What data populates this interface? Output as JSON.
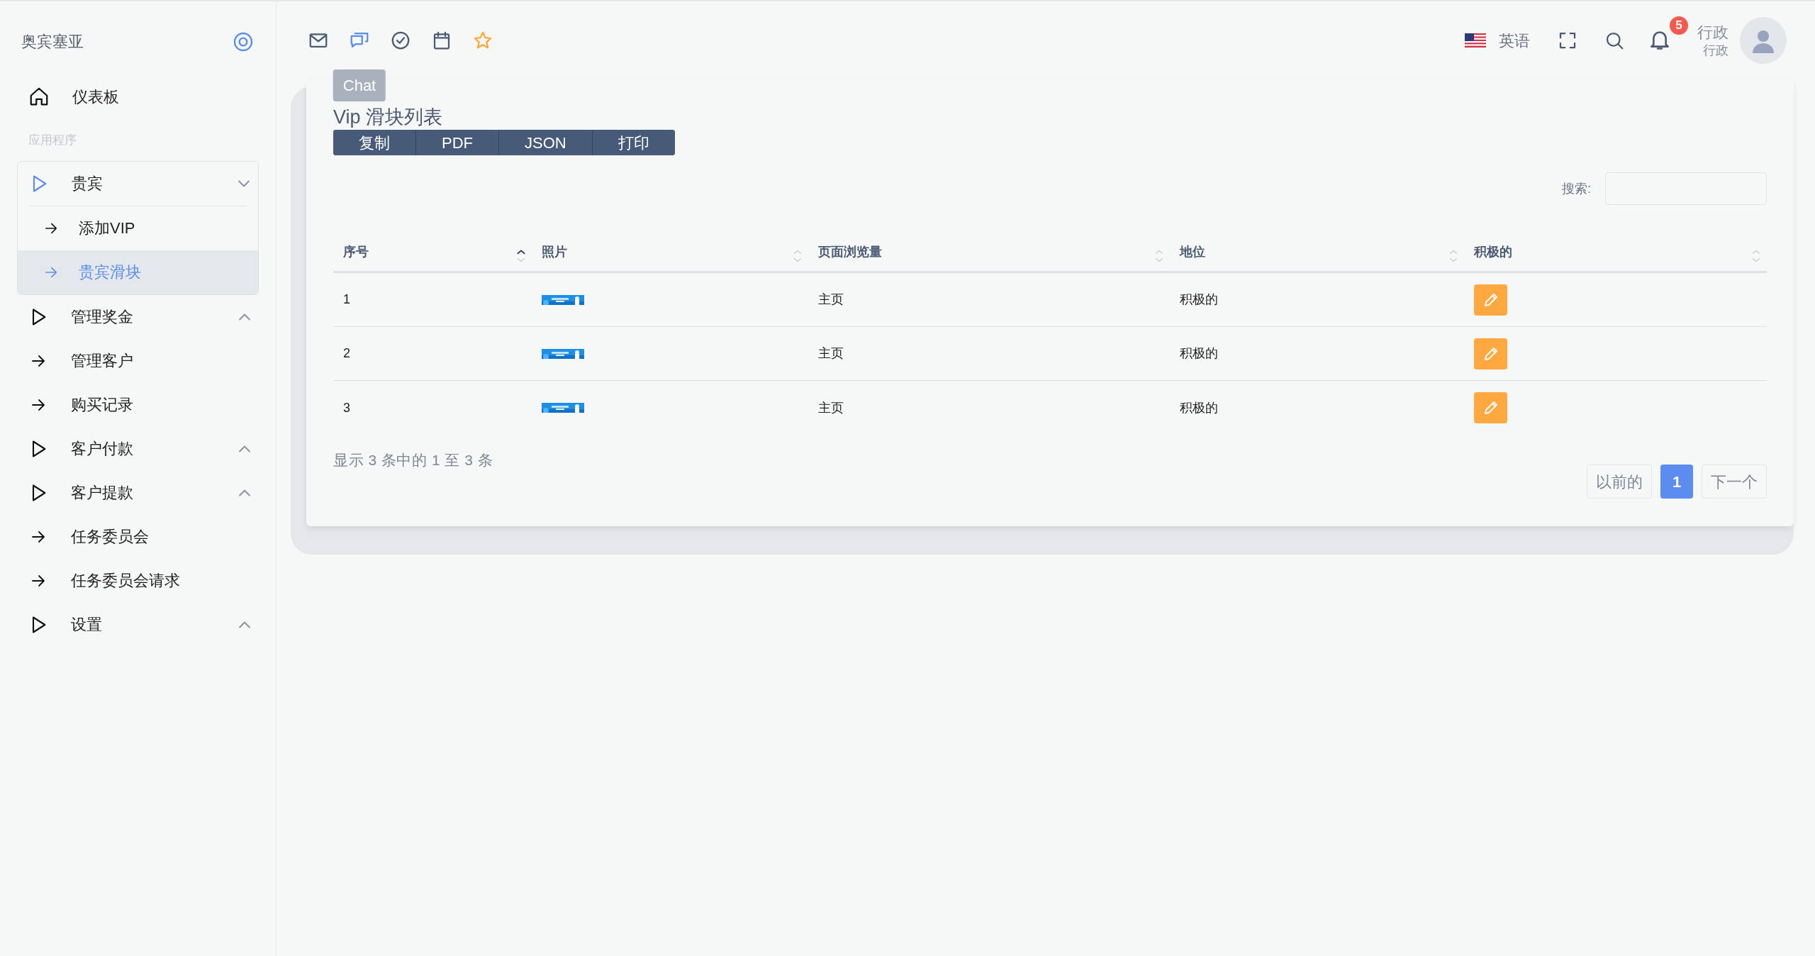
{
  "sidebar": {
    "brand": "奥宾塞亚",
    "items": [
      {
        "kind": "home",
        "label": "仪表板"
      },
      {
        "kind": "section",
        "label": "应用程序"
      },
      {
        "kind": "group",
        "label": "贵宾",
        "expanded": true,
        "children": [
          {
            "label": "添加VIP",
            "selected": false
          },
          {
            "label": "贵宾滑块",
            "selected": true
          }
        ]
      },
      {
        "kind": "group",
        "label": "管理奖金",
        "expanded": false
      },
      {
        "kind": "link",
        "label": "管理客户"
      },
      {
        "kind": "link",
        "label": "购买记录"
      },
      {
        "kind": "group",
        "label": "客户付款",
        "expanded": false
      },
      {
        "kind": "group",
        "label": "客户提款",
        "expanded": false
      },
      {
        "kind": "link",
        "label": "任务委员会"
      },
      {
        "kind": "link",
        "label": "任务委员会请求"
      },
      {
        "kind": "group",
        "label": "设置",
        "expanded": false
      }
    ]
  },
  "toolbar": {
    "icons": [
      {
        "kind": "mail",
        "selected": false
      },
      {
        "kind": "chat",
        "selected": true,
        "tooltip": "Chat"
      },
      {
        "kind": "check",
        "selected": false
      },
      {
        "kind": "calendar",
        "selected": false
      },
      {
        "kind": "star",
        "selected": false
      }
    ],
    "language": "英语",
    "notifications": "5",
    "user": {
      "name": "行政",
      "role": "行政"
    }
  },
  "card": {
    "title": "Vip 滑块列表",
    "export_buttons": [
      "复制",
      "PDF",
      "JSON",
      "打印"
    ],
    "search_label": "搜索:",
    "table": {
      "columns": [
        {
          "label": "序号",
          "sorted": true
        },
        {
          "label": "照片",
          "sorted": false
        },
        {
          "label": "页面浏览量",
          "sorted": false
        },
        {
          "label": "地位",
          "sorted": false
        },
        {
          "label": "积极的",
          "sorted": false
        }
      ],
      "rows": [
        {
          "index": "1",
          "page": "主页",
          "status": "积极的"
        },
        {
          "index": "2",
          "page": "主页",
          "status": "积极的"
        },
        {
          "index": "3",
          "page": "主页",
          "status": "积极的"
        }
      ]
    },
    "info": "显示 3 条中的 1 至 3 条",
    "pagination": [
      {
        "label": "以前的",
        "selected": false
      },
      {
        "label": "1",
        "selected": true
      },
      {
        "label": "下一个",
        "selected": false
      }
    ]
  }
}
